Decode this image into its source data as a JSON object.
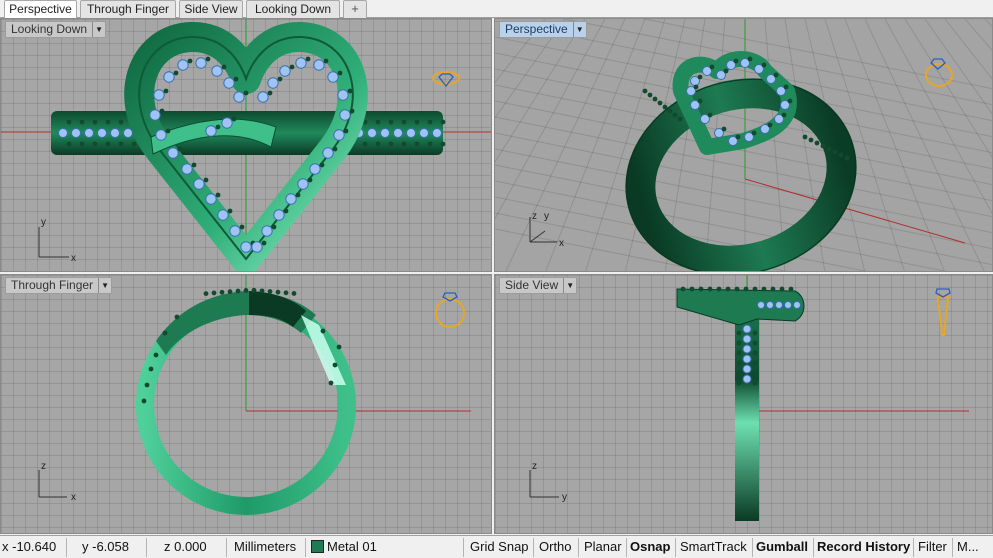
{
  "tabs": [
    {
      "label": "Perspective",
      "active": true
    },
    {
      "label": "Through Finger",
      "active": false
    },
    {
      "label": "Side View",
      "active": false
    },
    {
      "label": "Looking Down",
      "active": false
    }
  ],
  "add_tab_icon": "+",
  "viewports": {
    "top_left": {
      "label": "Looking Down",
      "axes": [
        "y",
        "x"
      ]
    },
    "top_right": {
      "label": "Perspective",
      "axes": [
        "z",
        "y",
        "x"
      ]
    },
    "bottom_left": {
      "label": "Through Finger",
      "axes": [
        "z",
        "x"
      ]
    },
    "bottom_right": {
      "label": "Side View",
      "axes": [
        "z",
        "y"
      ]
    }
  },
  "status": {
    "x": "x -10.640",
    "y": "y -6.058",
    "z": "z 0.000",
    "units": "Millimeters",
    "layer": "Metal 01",
    "layer_color": "#1f7a55",
    "buttons": [
      {
        "label": "Grid Snap",
        "bold": false
      },
      {
        "label": "Ortho",
        "bold": false
      },
      {
        "label": "Planar",
        "bold": false
      },
      {
        "label": "Osnap",
        "bold": true
      },
      {
        "label": "SmartTrack",
        "bold": false
      },
      {
        "label": "Gumball",
        "bold": true
      },
      {
        "label": "Record History",
        "bold": true
      },
      {
        "label": "Filter",
        "bold": false
      },
      {
        "label": "M...",
        "bold": false
      }
    ]
  },
  "colors": {
    "metal": "#1f8a5c",
    "metal_dark": "#0c3d26",
    "metal_light": "#7fe8c0",
    "gem": "#9fc4f4",
    "icon": "#e8a626",
    "x_axis": "#b03030",
    "y_axis": "#2c9a2c"
  }
}
